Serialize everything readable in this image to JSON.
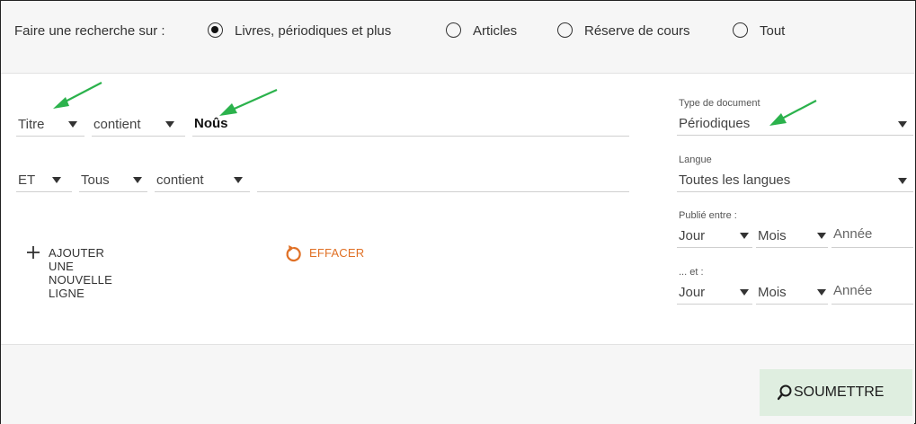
{
  "scope": {
    "label": "Faire une recherche sur :",
    "options": [
      {
        "label": "Livres, périodiques et plus",
        "selected": true
      },
      {
        "label": "Articles",
        "selected": false
      },
      {
        "label": "Réserve de cours",
        "selected": false
      },
      {
        "label": "Tout",
        "selected": false
      }
    ]
  },
  "query_rows": [
    {
      "field": "Titre",
      "operator": "contient",
      "value": "Noûs"
    },
    {
      "boolean": "ET",
      "field": "Tous",
      "operator": "contient",
      "value": ""
    }
  ],
  "actions": {
    "add_row": "AJOUTER UNE NOUVELLE LIGNE",
    "clear": "EFFACER"
  },
  "filters": {
    "document_type": {
      "label": "Type de document",
      "value": "Périodiques"
    },
    "language": {
      "label": "Langue",
      "value": "Toutes les langues"
    },
    "published_between": {
      "label": "Publié entre :",
      "day": "Jour",
      "month": "Mois",
      "year_placeholder": "Année"
    },
    "and": {
      "label": "... et :",
      "day": "Jour",
      "month": "Mois",
      "year_placeholder": "Année"
    }
  },
  "submit_label": "SOUMETTRE",
  "colors": {
    "accent_orange": "#e07025",
    "annotation_green": "#2bb24c",
    "submit_bg": "#dfeee0"
  }
}
